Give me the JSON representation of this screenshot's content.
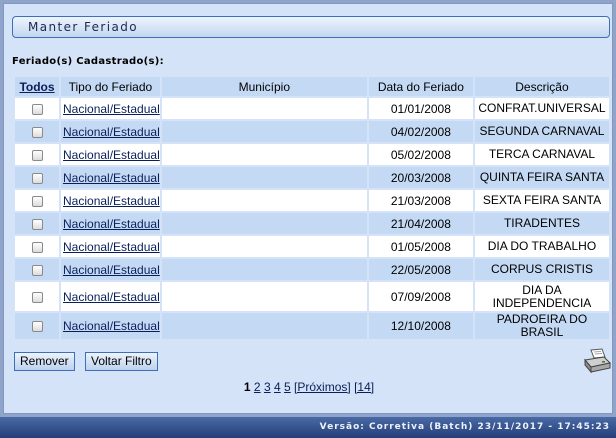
{
  "title": "Manter Feriado",
  "section_label": "Feriado(s) Cadastrado(s):",
  "columns": {
    "todos": "Todos",
    "tipo": "Tipo do Feriado",
    "municipio": "Município",
    "data": "Data do Feriado",
    "descricao": "Descrição"
  },
  "rows": [
    {
      "tipo": "Nacional/Estadual",
      "municipio": "",
      "data": "01/01/2008",
      "descricao": "CONFRAT.UNIVERSAL",
      "checked": false
    },
    {
      "tipo": "Nacional/Estadual",
      "municipio": "",
      "data": "04/02/2008",
      "descricao": "SEGUNDA CARNAVAL",
      "checked": false
    },
    {
      "tipo": "Nacional/Estadual",
      "municipio": "",
      "data": "05/02/2008",
      "descricao": "TERCA CARNAVAL",
      "checked": false
    },
    {
      "tipo": "Nacional/Estadual",
      "municipio": "",
      "data": "20/03/2008",
      "descricao": "QUINTA FEIRA SANTA",
      "checked": false
    },
    {
      "tipo": "Nacional/Estadual",
      "municipio": "",
      "data": "21/03/2008",
      "descricao": "SEXTA FEIRA SANTA",
      "checked": false
    },
    {
      "tipo": "Nacional/Estadual",
      "municipio": "",
      "data": "21/04/2008",
      "descricao": "TIRADENTES",
      "checked": false
    },
    {
      "tipo": "Nacional/Estadual",
      "municipio": "",
      "data": "01/05/2008",
      "descricao": "DIA DO TRABALHO",
      "checked": false
    },
    {
      "tipo": "Nacional/Estadual",
      "municipio": "",
      "data": "22/05/2008",
      "descricao": "CORPUS CRISTIS",
      "checked": false
    },
    {
      "tipo": "Nacional/Estadual",
      "municipio": "",
      "data": "07/09/2008",
      "descricao": "DIA DA INDEPENDENCIA",
      "checked": false
    },
    {
      "tipo": "Nacional/Estadual",
      "municipio": "",
      "data": "12/10/2008",
      "descricao": "PADROEIRA DO BRASIL",
      "checked": false
    }
  ],
  "buttons": {
    "remover": "Remover",
    "voltar": "Voltar Filtro"
  },
  "printer_icon": "printer-icon",
  "pager": {
    "current": "1",
    "pages": [
      "2",
      "3",
      "4",
      "5"
    ],
    "next": "[Próximos]",
    "last": "[14]"
  },
  "footer": "Versão: Corretiva (Batch) 23/11/2017 - 17:45:23",
  "colors": {
    "background": "#8fa4c8",
    "panel": "#d4e3f7",
    "row_alt": "#c4daf4",
    "footer": "#2f4b86"
  }
}
